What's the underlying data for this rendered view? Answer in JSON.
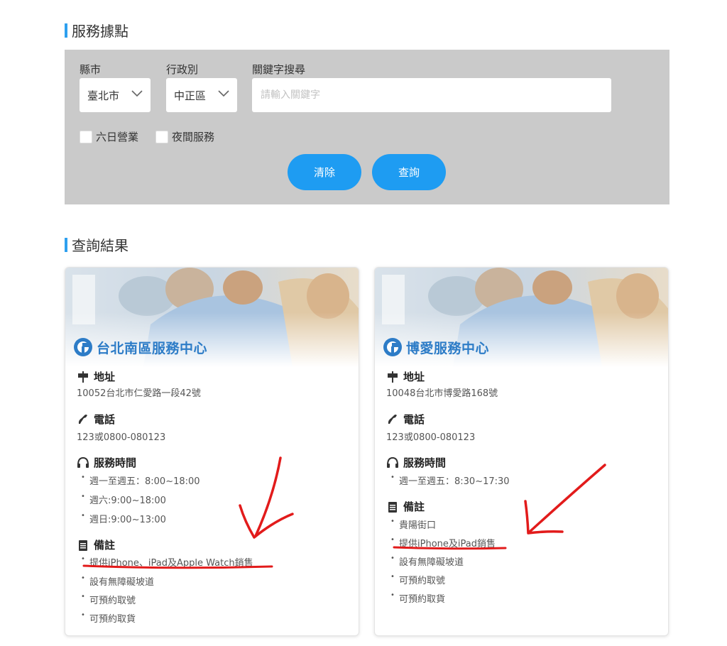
{
  "section1": {
    "title": "服務據點"
  },
  "filters": {
    "city_label": "縣市",
    "city_value": "臺北市",
    "district_label": "行政別",
    "district_value": "中正區",
    "keyword_label": "關鍵字搜尋",
    "keyword_placeholder": "請輸入關鍵字",
    "keyword_value": "",
    "check1_label": "六日營業",
    "check2_label": "夜間服務",
    "clear_label": "清除",
    "search_label": "查詢"
  },
  "section2": {
    "title": "查詢結果"
  },
  "stores": [
    {
      "name": "台北南區服務中心",
      "address_label": "地址",
      "address": "10052台北市仁愛路一段42號",
      "phone_label": "電話",
      "phone": "123或0800-080123",
      "hours_label": "服務時間",
      "hours": [
        "週一至週五：8:00~18:00",
        "週六:9:00~18:00",
        "週日:9:00~13:00"
      ],
      "notes_label": "備註",
      "notes": [
        "提供iPhone、iPad及Apple Watch銷售",
        "設有無障礙坡道",
        "可預約取號",
        "可預約取貨"
      ]
    },
    {
      "name": "博愛服務中心",
      "address_label": "地址",
      "address": "10048台北市博愛路168號",
      "phone_label": "電話",
      "phone": "123或0800-080123",
      "hours_label": "服務時間",
      "hours": [
        "週一至週五：8:30~17:30"
      ],
      "notes_label": "備註",
      "notes": [
        "貴陽街口",
        "提供iPhone及iPad銷售",
        "設有無障礙坡道",
        "可預約取號",
        "可預約取貨"
      ]
    }
  ],
  "colors": {
    "accent": "#1e9cf2",
    "panel": "#cacaca",
    "annotation": "#e21b1b",
    "brand_text": "#2d7cc7"
  }
}
